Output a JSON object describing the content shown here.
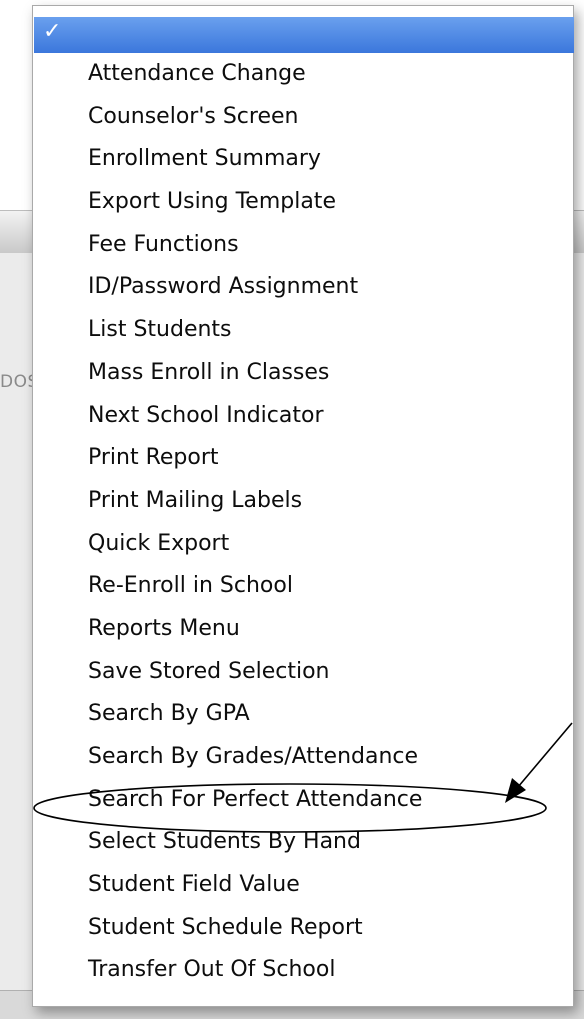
{
  "menu": {
    "selected_mark": "✓",
    "items": [
      "Attendance Change",
      "Counselor's Screen",
      "Enrollment Summary",
      "Export Using Template",
      "Fee Functions",
      "ID/Password Assignment",
      "List Students",
      "Mass Enroll in Classes",
      "Next School Indicator",
      "Print Report",
      "Print Mailing Labels",
      "Quick Export",
      "Re-Enroll in School",
      "Reports Menu",
      "Save Stored Selection",
      "Search By GPA",
      "Search By Grades/Attendance",
      "Search For Perfect Attendance",
      "Select Students By Hand",
      "Student Field Value",
      "Student Schedule Report",
      "Transfer Out Of School"
    ]
  },
  "background": {
    "ghost_left_text": "DOS"
  },
  "colors": {
    "highlight": "#3b77dc",
    "annotation": "#000000"
  }
}
